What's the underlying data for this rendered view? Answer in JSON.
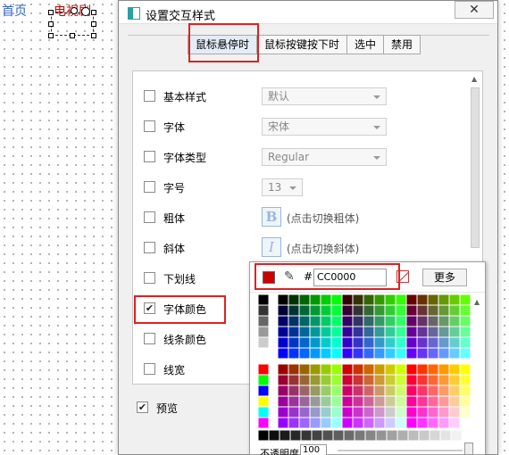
{
  "canvas": {
    "nav_home": "首页",
    "nav_tv": "电视剧",
    "colors": {
      "link": "#3366cc",
      "selected_text": "#cc0000"
    }
  },
  "dialog": {
    "title": "设置交互样式",
    "close_label": "✕",
    "tabs": [
      "鼠标悬停时",
      "鼠标按键按下时",
      "选中",
      "禁用"
    ],
    "active_tab": "鼠标悬停时",
    "rows": [
      {
        "label": "基本样式",
        "checked": false,
        "control": "select",
        "value": "默认"
      },
      {
        "label": "字体",
        "checked": false,
        "control": "select",
        "value": "宋体"
      },
      {
        "label": "字体类型",
        "checked": false,
        "control": "select",
        "value": "Regular"
      },
      {
        "label": "字号",
        "checked": false,
        "control": "select-small",
        "value": "13"
      },
      {
        "label": "粗体",
        "checked": false,
        "control": "toggle",
        "glyph": "B",
        "hint": "(点击切换粗体)"
      },
      {
        "label": "斜体",
        "checked": false,
        "control": "toggle",
        "glyph": "I",
        "hint": "(点击切换斜体)"
      },
      {
        "label": "下划线",
        "checked": false,
        "control": "none"
      },
      {
        "label": "字体颜色",
        "checked": true,
        "control": "none"
      },
      {
        "label": "线条颜色",
        "checked": false,
        "control": "none"
      },
      {
        "label": "线宽",
        "checked": false,
        "control": "none"
      }
    ],
    "preview_label": "预览",
    "preview_checked": true
  },
  "color_picker": {
    "current_color": "#CC0000",
    "hash": "#",
    "hex_value": "CC0000",
    "more_label": "更多",
    "opacity_label": "不透明度",
    "opacity_value": "100",
    "opacity": 1.0
  },
  "highlight_color": "#e02020"
}
